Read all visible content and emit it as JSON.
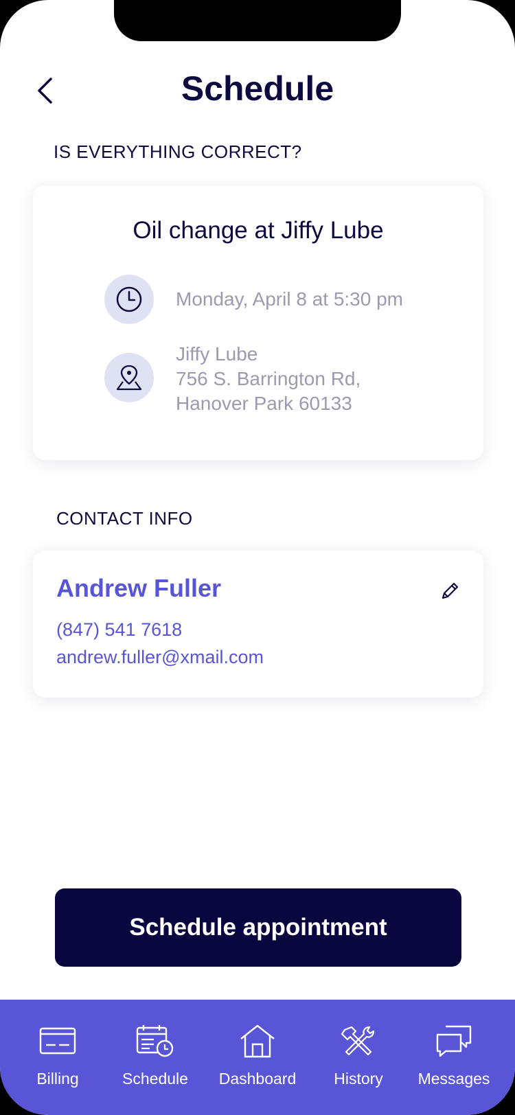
{
  "header": {
    "title": "Schedule",
    "back_icon": "chevron-left-icon"
  },
  "confirm_section": {
    "label": "IS EVERYTHING CORRECT?"
  },
  "appointment": {
    "title": "Oil change at Jiffy Lube",
    "time_icon": "clock-icon",
    "datetime": "Monday, April 8 at 5:30 pm",
    "location_icon": "map-pin-icon",
    "location_name": "Jiffy Lube",
    "address_line1": "756 S. Barrington Rd,",
    "address_line2": "Hanover Park 60133"
  },
  "contact_section": {
    "label": "CONTACT INFO"
  },
  "contact": {
    "name": "Andrew Fuller",
    "phone": "(847) 541 7618",
    "email": "andrew.fuller@xmail.com",
    "edit_icon": "pencil-icon"
  },
  "cta": {
    "label": "Schedule appointment"
  },
  "tab_bar": {
    "items": [
      {
        "label": "Billing",
        "icon": "credit-card-icon"
      },
      {
        "label": "Schedule",
        "icon": "calendar-clock-icon"
      },
      {
        "label": "Dashboard",
        "icon": "home-icon"
      },
      {
        "label": "History",
        "icon": "wrench-hammer-icon"
      },
      {
        "label": "Messages",
        "icon": "chat-bubbles-icon"
      }
    ]
  },
  "colors": {
    "primary": "#5856d6",
    "navy": "#09053f",
    "muted_text": "#9a9bb0",
    "icon_bg": "#dfe2f3"
  }
}
